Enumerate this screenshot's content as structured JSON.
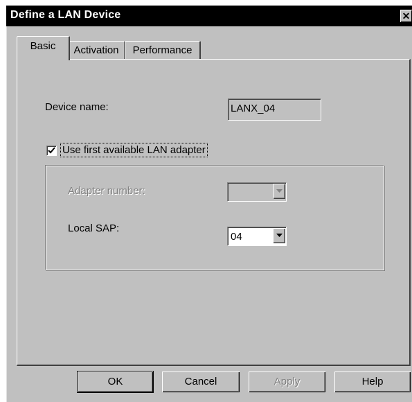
{
  "window": {
    "title": "Define a LAN Device",
    "close_glyph": "✕"
  },
  "tabs": [
    {
      "label": "Basic",
      "active": true
    },
    {
      "label": "Activation",
      "active": false
    },
    {
      "label": "Performance",
      "active": false
    }
  ],
  "basic": {
    "device_name_label": "Device name:",
    "device_name_value": "LANX_04",
    "use_first_adapter_label": "Use first available LAN adapter",
    "use_first_adapter_checked": true,
    "adapter_number_label": "Adapter number:",
    "adapter_number_value": "",
    "local_sap_label": "Local SAP:",
    "local_sap_value": "04"
  },
  "buttons": {
    "ok": "OK",
    "cancel": "Cancel",
    "apply": "Apply",
    "help": "Help"
  },
  "colors": {
    "face": "#c0c0c0",
    "titlebar": "#000000",
    "disabled_text": "#808080"
  },
  "icons": {
    "checkmark": "checkmark-icon",
    "dropdown": "chevron-down-icon",
    "close": "close-icon"
  }
}
